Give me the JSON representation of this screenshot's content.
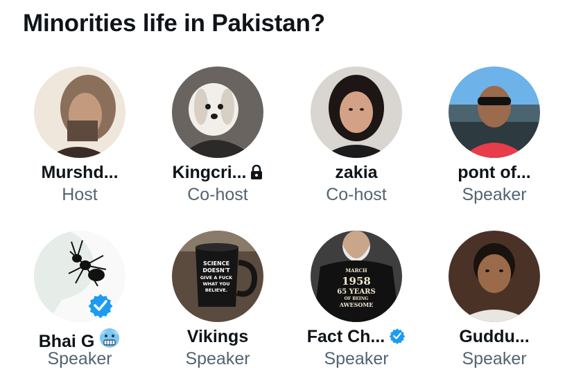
{
  "space": {
    "title": "Minorities life in Pakistan?"
  },
  "participants": [
    {
      "name": "Murshd...",
      "role": "Host",
      "avatar": "man-long-hair-photo"
    },
    {
      "name": "Kingcri...",
      "role": "Co-host",
      "avatar": "white-dog-photo",
      "name_icon": "lock-icon"
    },
    {
      "name": "zakia",
      "role": "Co-host",
      "avatar": "woman-photo"
    },
    {
      "name": "pont of...",
      "role": "Speaker",
      "avatar": "man-sunglasses-boat-photo"
    },
    {
      "name": "Bhai G",
      "role": "Speaker",
      "avatar": "ant-drawing",
      "name_icon": "cold-face-emoji",
      "avatar_badge": "verified-badge-icon"
    },
    {
      "name": "Vikings",
      "role": "Speaker",
      "avatar": "mug-photo",
      "mug_text": [
        "SCIENCE",
        "DOESN'T",
        "GIVE A FUCK",
        "WHAT YOU",
        "BELIEVE."
      ]
    },
    {
      "name": "Fact Ch...",
      "role": "Speaker",
      "avatar": "bearded-man-tshirt-photo",
      "name_icon": "verified-badge-icon",
      "shirt_text": [
        "MARCH",
        "1958",
        "65 YEARS",
        "OF BEING",
        "AWESOME"
      ]
    },
    {
      "name": "Guddu...",
      "role": "Speaker",
      "avatar": "boy-photo"
    }
  ],
  "colors": {
    "verified": "#1d9bf0",
    "role_text": "#536471",
    "name_text": "#0f1419"
  }
}
